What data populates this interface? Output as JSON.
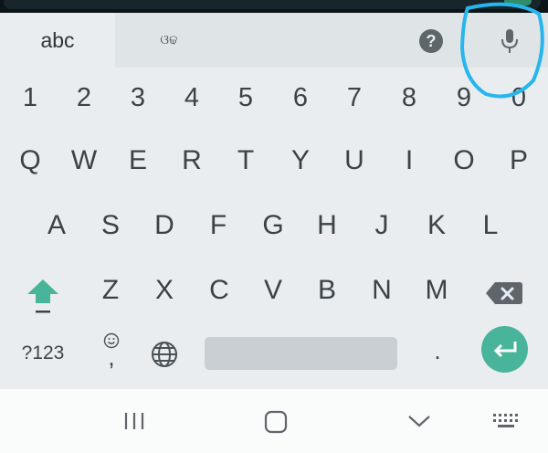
{
  "keyboard": {
    "tabs": {
      "active": "abc",
      "secondary": "ଓଢ"
    },
    "toolbar_icons": [
      "help-icon",
      "mic-icon"
    ],
    "number_row": [
      "1",
      "2",
      "3",
      "4",
      "5",
      "6",
      "7",
      "8",
      "9",
      "0"
    ],
    "row_q": [
      "Q",
      "W",
      "E",
      "R",
      "T",
      "Y",
      "U",
      "I",
      "O",
      "P"
    ],
    "row_a": [
      "A",
      "S",
      "D",
      "F",
      "G",
      "H",
      "J",
      "K",
      "L"
    ],
    "row_z": [
      "Z",
      "X",
      "C",
      "V",
      "B",
      "N",
      "M"
    ],
    "bottom_row": {
      "symbols": "?123",
      "comma": ",",
      "period": "."
    },
    "colors": {
      "accent": "#48b59a",
      "background": "#e9edf0",
      "key_text": "#3b4247",
      "annotation": "#27b6ec"
    }
  },
  "navbar": {
    "icons": [
      "recent-apps-icon",
      "home-icon",
      "back-icon",
      "keyboard-hide-icon"
    ]
  }
}
